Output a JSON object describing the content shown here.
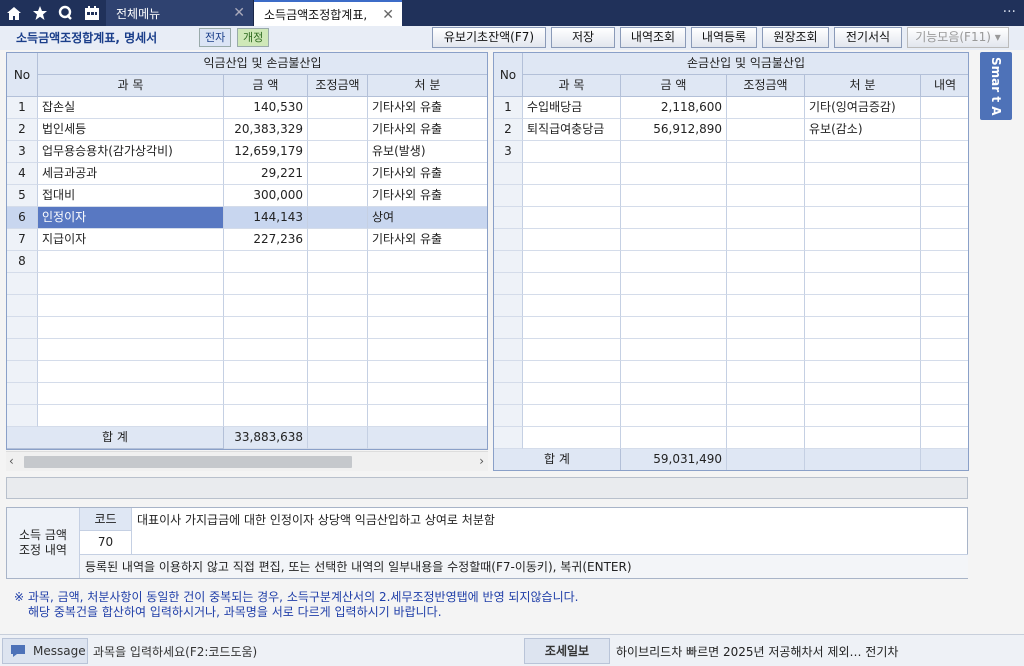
{
  "topbar": {
    "menu_label": "전체메뉴",
    "active_tab": "소득금액조정합계표,",
    "more": "···"
  },
  "toolbar": {
    "title": "소득금액조정합계표, 명세서",
    "badge1": "전자",
    "badge2": "개정",
    "buttons": [
      "유보기초잔액(F7)",
      "저장",
      "내역조회",
      "내역등록",
      "원장조회",
      "전기서식"
    ],
    "feature_button": "기능모음(F11)"
  },
  "left": {
    "group_header": "익금산입 및 손금불산입",
    "cols": [
      "No",
      "과   목",
      "금   액",
      "조정금액",
      "처   분"
    ],
    "rows": [
      {
        "no": "1",
        "subject": "잡손실",
        "amount": "140,530",
        "adj": "",
        "disp": "기타사외 유출"
      },
      {
        "no": "2",
        "subject": "법인세등",
        "amount": "20,383,329",
        "adj": "",
        "disp": "기타사외 유출"
      },
      {
        "no": "3",
        "subject": "업무용승용차(감가상각비)",
        "amount": "12,659,179",
        "adj": "",
        "disp": "유보(발생)"
      },
      {
        "no": "4",
        "subject": "세금과공과",
        "amount": "29,221",
        "adj": "",
        "disp": "기타사외 유출"
      },
      {
        "no": "5",
        "subject": "접대비",
        "amount": "300,000",
        "adj": "",
        "disp": "기타사외 유출"
      },
      {
        "no": "6",
        "subject": "인정이자",
        "amount": "144,143",
        "adj": "",
        "disp": "상여"
      },
      {
        "no": "7",
        "subject": "지급이자",
        "amount": "227,236",
        "adj": "",
        "disp": "기타사외 유출"
      },
      {
        "no": "8",
        "subject": "",
        "amount": "",
        "adj": "",
        "disp": ""
      }
    ],
    "total_label": "합 계",
    "total": "33,883,638"
  },
  "right": {
    "group_header": "손금산입 및 익금불산입",
    "cols": [
      "No",
      "과   목",
      "금   액",
      "조정금액",
      "처   분",
      "내역"
    ],
    "rows": [
      {
        "no": "1",
        "subject": "수입배당금",
        "amount": "2,118,600",
        "adj": "",
        "disp": "기타(잉여금증감)"
      },
      {
        "no": "2",
        "subject": "퇴직급여충당금",
        "amount": "56,912,890",
        "adj": "",
        "disp": "유보(감소)"
      },
      {
        "no": "3",
        "subject": "",
        "amount": "",
        "adj": "",
        "disp": ""
      }
    ],
    "total_label": "합 계",
    "total": "59,031,490"
  },
  "smart_tab": "Smar t A",
  "detail": {
    "label1": "소득 금액",
    "label2": "조정 내역",
    "code_header": "코드",
    "code_value": "70",
    "description": "대표이사 가지급금에 대한 인정이자 상당액 익금산입하고 상여로 처분함",
    "hint": "등록된 내역을 이용하지 않고 직접 편집, 또는 선택한 내역의 일부내용을 수정할때(F7-이동키), 복귀(ENTER)"
  },
  "notes": {
    "line1": "※ 과목, 금액, 처분사항이 동일한 건이 중복되는 경우, 소득구분계산서의 2.세무조정반영탭에 반영 되지않습니다.",
    "line2": "해당 중복건을 합산하여 입력하시거나, 과목명을 서로 다르게 입력하시기 바랍니다."
  },
  "status": {
    "message_label": "Message",
    "prompt": "과목을 입력하세요(F2:코드도움)",
    "news_label": "조세일보",
    "news_text": "하이브리드차 빠르면 2025년 저공해차서 제외… 전기차"
  }
}
